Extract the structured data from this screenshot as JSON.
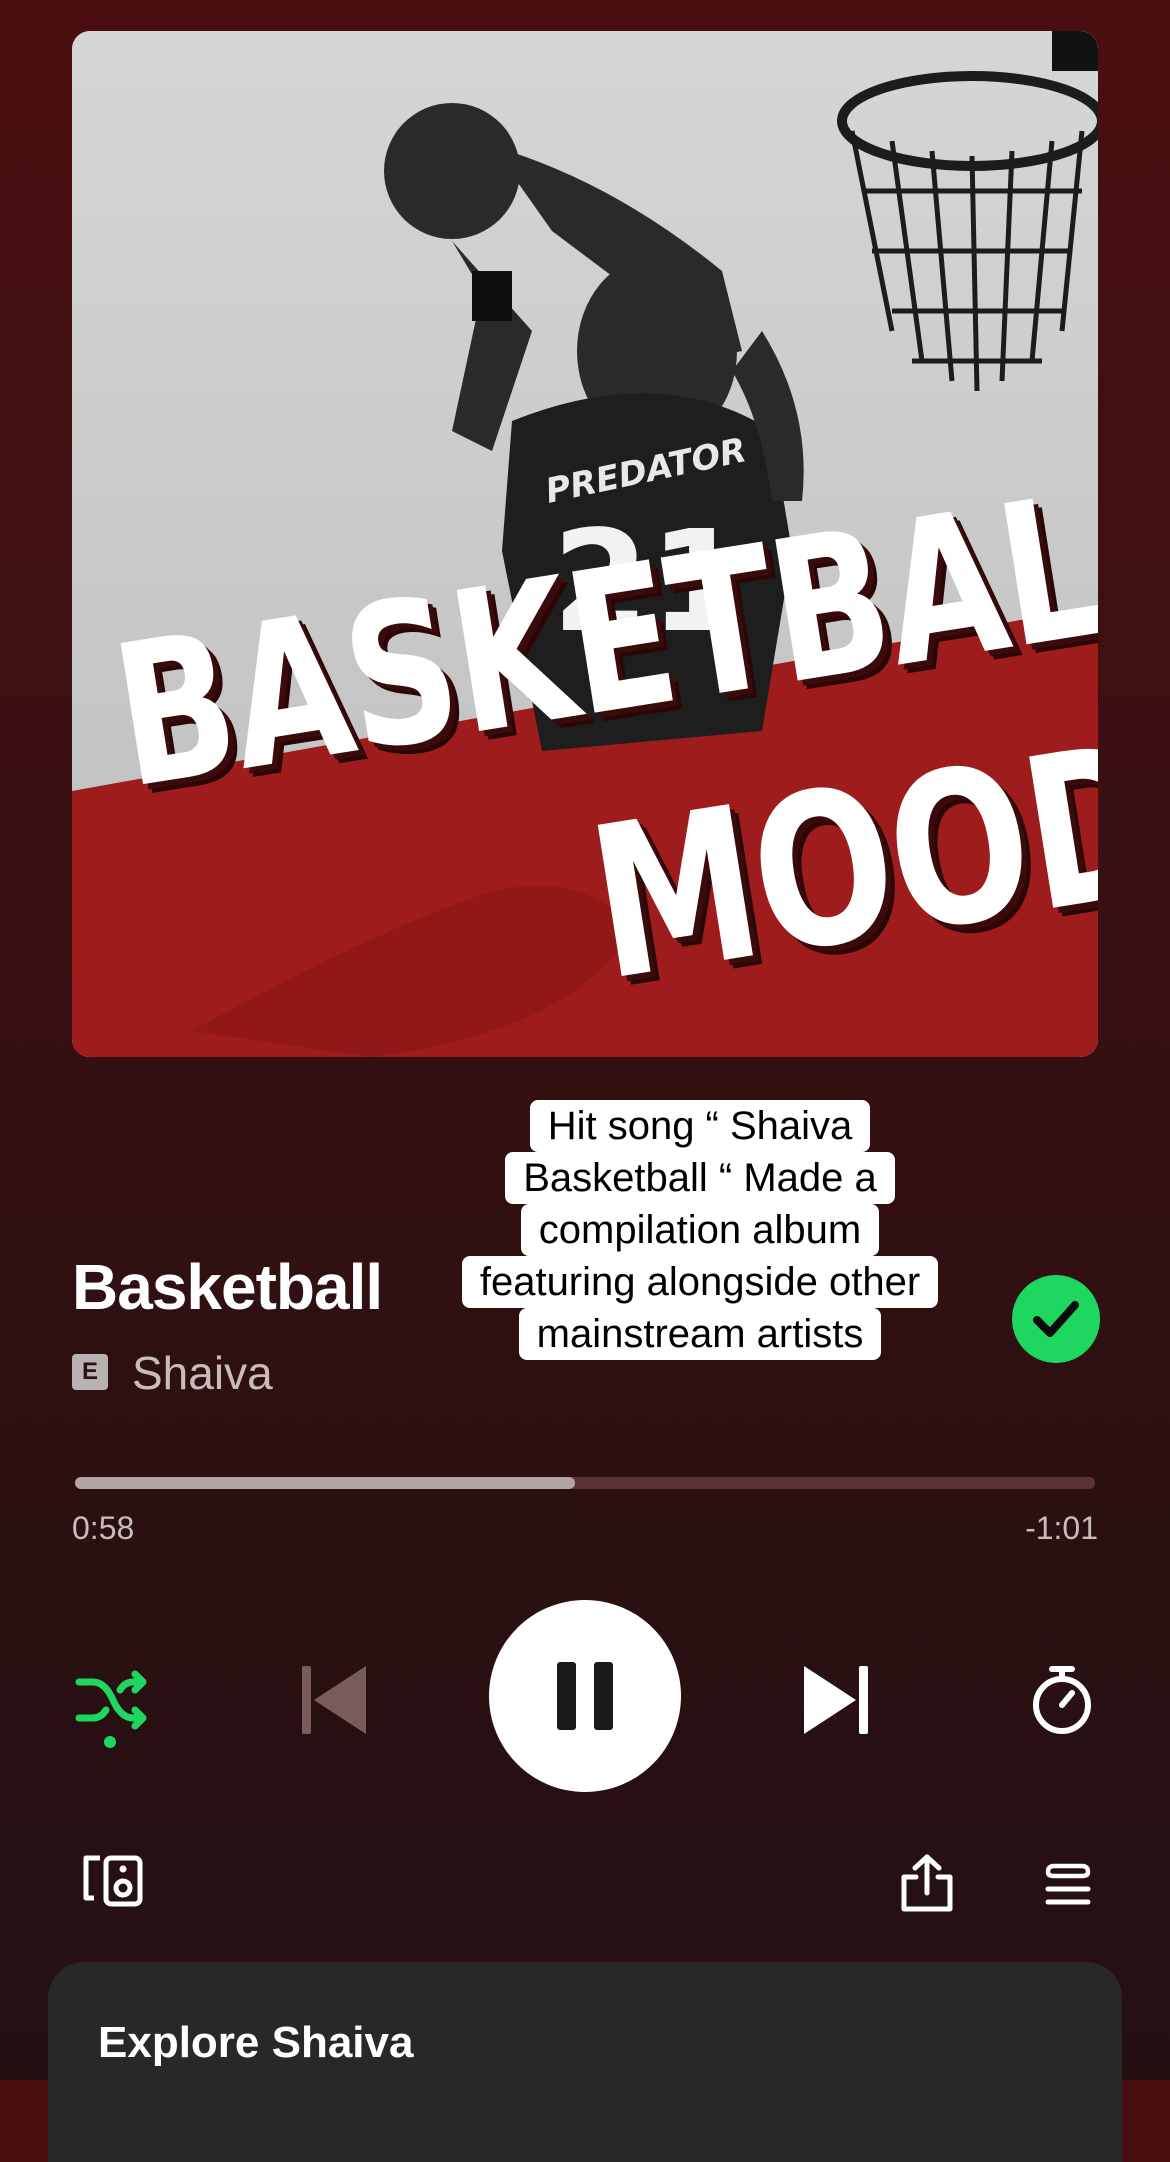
{
  "album_art": {
    "line1": "BASKETBALL",
    "line2": "MOOD",
    "jersey_brand": "PREDATOR",
    "jersey_number": "21"
  },
  "caption": {
    "lines": [
      "Hit song “ Shaiva",
      "Basketball “ Made a",
      "compilation album",
      "featuring alongside other",
      "mainstream artists"
    ]
  },
  "track": {
    "title": "Basketball",
    "explicit_label": "E",
    "artist": "Shaiva",
    "liked": true
  },
  "playback": {
    "progress_fraction": 0.49,
    "elapsed": "0:58",
    "remaining": "-1:01",
    "state": "playing"
  },
  "icons": {
    "shuffle": "shuffle-icon",
    "previous": "skip-previous-icon",
    "pause": "pause-icon",
    "next": "skip-next-icon",
    "timer": "sleep-timer-icon",
    "devices": "connect-devices-icon",
    "share": "share-icon",
    "queue": "queue-icon"
  },
  "colors": {
    "accent": "#1ed760",
    "background": "#3a1012"
  },
  "explore": {
    "title": "Explore Shaiva"
  }
}
